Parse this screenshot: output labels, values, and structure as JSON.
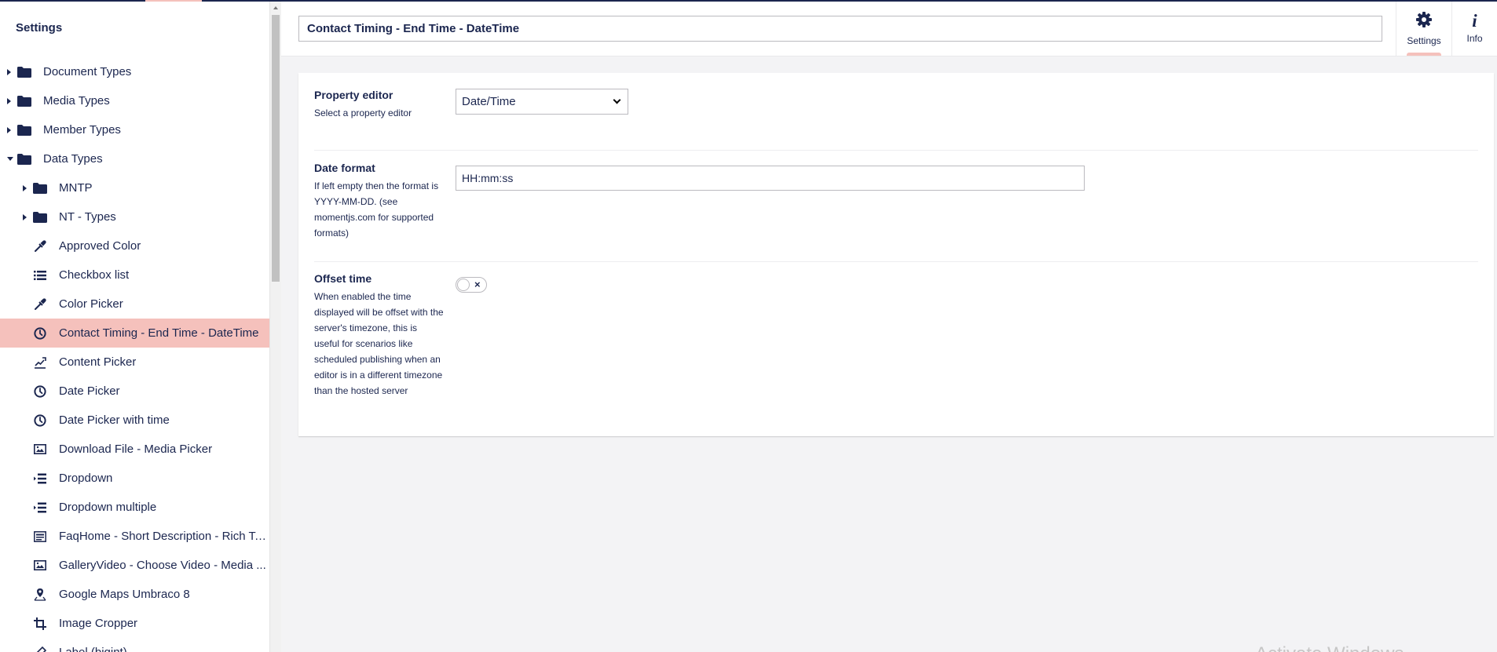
{
  "sidebar": {
    "title": "Settings",
    "items": [
      {
        "label": "Document Types",
        "icon": "folder-icon",
        "level": 0,
        "caret": "right"
      },
      {
        "label": "Media Types",
        "icon": "folder-icon",
        "level": 0,
        "caret": "right"
      },
      {
        "label": "Member Types",
        "icon": "folder-icon",
        "level": 0,
        "caret": "right"
      },
      {
        "label": "Data Types",
        "icon": "folder-icon",
        "level": 0,
        "caret": "down"
      },
      {
        "label": "MNTP",
        "icon": "folder-icon",
        "level": 1,
        "caret": "right"
      },
      {
        "label": "NT - Types",
        "icon": "folder-icon",
        "level": 1,
        "caret": "right"
      },
      {
        "label": "Approved Color",
        "icon": "eyedropper-icon",
        "level": 1
      },
      {
        "label": "Checkbox list",
        "icon": "list-icon",
        "level": 1
      },
      {
        "label": "Color Picker",
        "icon": "eyedropper-icon",
        "level": 1
      },
      {
        "label": "Contact Timing - End Time - DateTime",
        "icon": "clock-icon",
        "level": 1,
        "selected": true
      },
      {
        "label": "Content Picker",
        "icon": "content-picker-icon",
        "level": 1
      },
      {
        "label": "Date Picker",
        "icon": "clock-icon",
        "level": 1
      },
      {
        "label": "Date Picker with time",
        "icon": "clock-icon",
        "level": 1
      },
      {
        "label": "Download File - Media Picker",
        "icon": "picture-icon",
        "level": 1
      },
      {
        "label": "Dropdown",
        "icon": "dropdown-list-icon",
        "level": 1
      },
      {
        "label": "Dropdown multiple",
        "icon": "dropdown-list-icon",
        "level": 1
      },
      {
        "label": "FaqHome - Short Description - Rich Te...",
        "icon": "rich-text-icon",
        "level": 1
      },
      {
        "label": "GalleryVideo - Choose Video - Media ...",
        "icon": "picture-icon",
        "level": 1
      },
      {
        "label": "Google Maps Umbraco 8",
        "icon": "map-pin-icon",
        "level": 1
      },
      {
        "label": "Image Cropper",
        "icon": "crop-icon",
        "level": 1
      },
      {
        "label": "Label (bigint)",
        "icon": "pencil-icon",
        "level": 1
      }
    ]
  },
  "header": {
    "name_value": "Contact Timing - End Time - DateTime",
    "nav": {
      "settings_label": "Settings",
      "info_label": "Info"
    }
  },
  "properties": {
    "editor": {
      "label": "Property editor",
      "description": "Select a property editor",
      "value": "Date/Time"
    },
    "date_format": {
      "label": "Date format",
      "description": "If left empty then the format is YYYY-MM-DD. (see momentjs.com for supported formats)",
      "value": "HH:mm:ss"
    },
    "offset_time": {
      "label": "Offset time",
      "description": "When enabled the time displayed will be offset with the server's timezone, this is useful for scenarios like scheduled publishing when an editor is in a different timezone than the hosted server",
      "enabled": false
    }
  },
  "watermark": "Activate Windows",
  "colors": {
    "navy": "#1b264f",
    "selected": "#f5c1bc",
    "background": "#f3f3f5"
  }
}
